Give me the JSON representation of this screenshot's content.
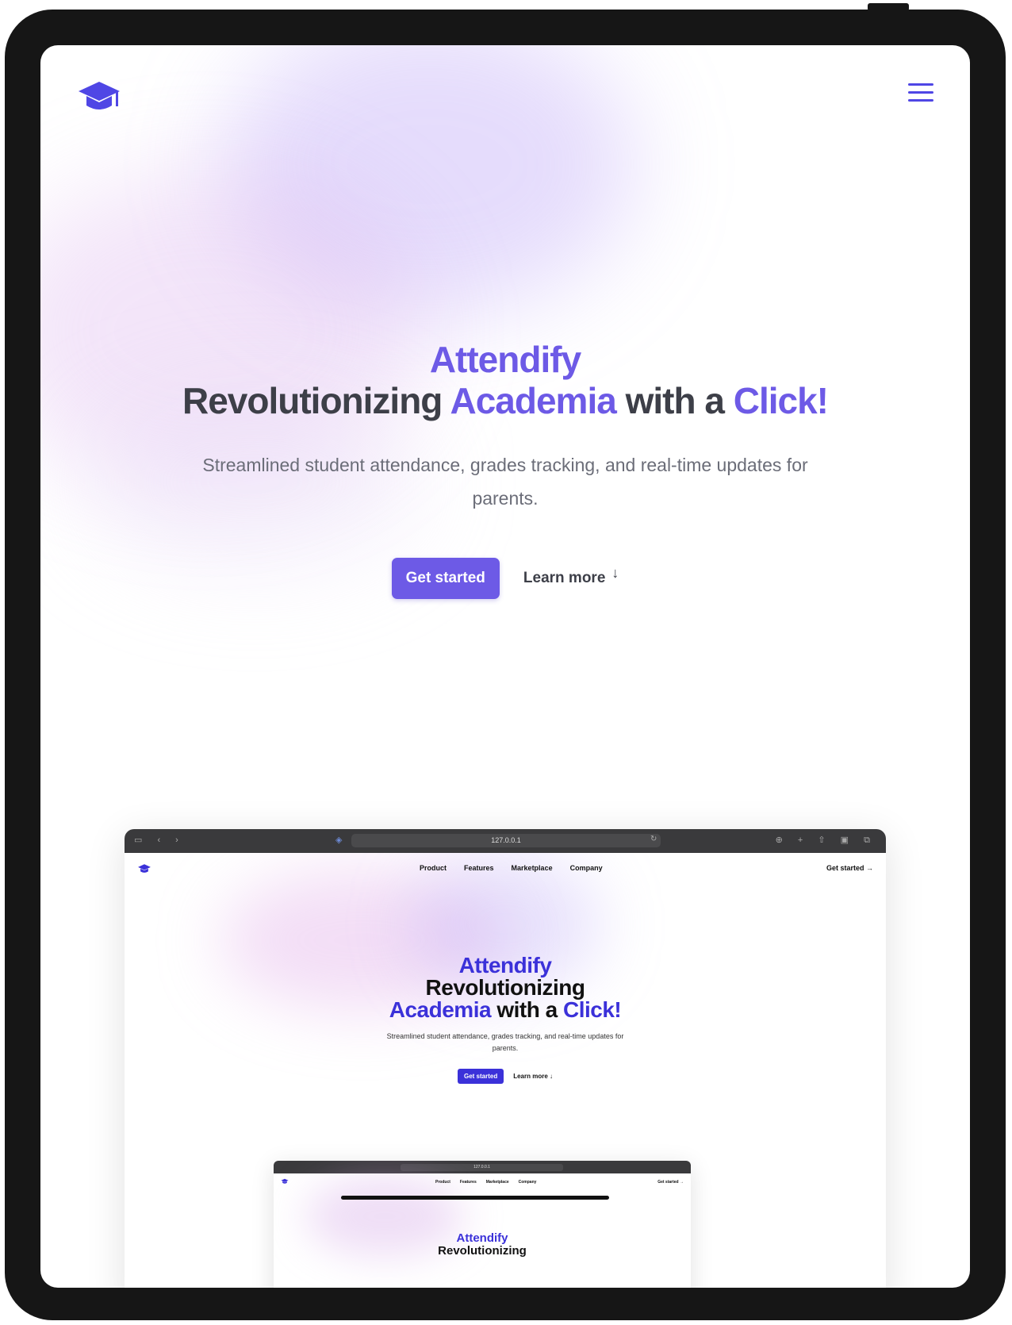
{
  "app": {
    "brand": "Attendify",
    "headline_part1": "Revolutionizing",
    "headline_highlight1": "Academia",
    "headline_part2": "with a",
    "headline_highlight2": "Click!",
    "subtitle": "Streamlined student attendance, grades tracking, and real-time updates for parents.",
    "primary_cta": "Get started",
    "secondary_cta": "Learn more",
    "secondary_cta_icon": "↓"
  },
  "colors": {
    "accent": "#6d5ae6",
    "inner_accent": "#3b31d9",
    "heading": "#3d3f48",
    "frame": "#161616"
  },
  "icons": {
    "logo": "graduation-cap-icon",
    "menu": "hamburger-menu-icon"
  },
  "preview": {
    "url": "127.0.0.1",
    "nav_links": [
      "Product",
      "Features",
      "Marketplace",
      "Company"
    ],
    "nav_cta": "Get started →",
    "brand": "Attendify",
    "headline_line1": "Revolutionizing",
    "headline_highlight1": "Academia",
    "headline_part2": "with a",
    "headline_highlight2": "Click!",
    "subtitle": "Streamlined student attendance, grades tracking, and real-time updates for parents.",
    "primary_cta": "Get started",
    "secondary_cta": "Learn more",
    "secondary_cta_icon": "↓"
  },
  "preview_nested": {
    "url": "127.0.0.1",
    "nav_links": [
      "Product",
      "Features",
      "Marketplace",
      "Company"
    ],
    "nav_cta": "Get started →",
    "brand": "Attendify",
    "headline_line1": "Revolutionizing"
  }
}
